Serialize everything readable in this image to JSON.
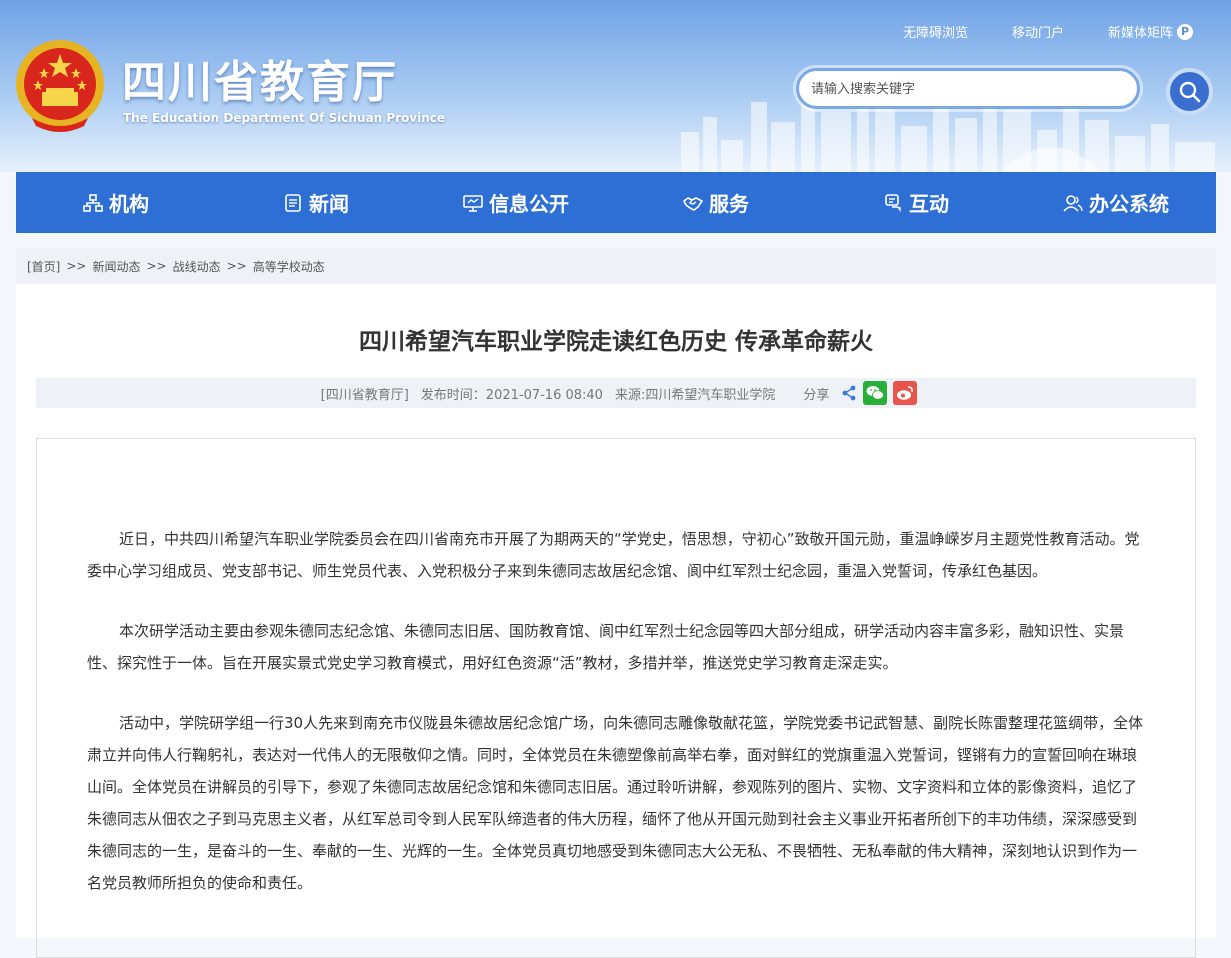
{
  "header": {
    "title": "四川省教育厅",
    "subtitle": "The Education Department Of Sichuan Province",
    "top_links": [
      "无障碍浏览",
      "移动门户",
      "新媒体矩阵"
    ],
    "search_placeholder": "请输入搜索关键字"
  },
  "nav": {
    "items": [
      "机构",
      "新闻",
      "信息公开",
      "服务",
      "互动",
      "办公系统"
    ]
  },
  "breadcrumb": {
    "items": [
      "[首页]",
      "新闻动态",
      "战线动态",
      "高等学校动态"
    ],
    "separator": ">>"
  },
  "article": {
    "title": "四川希望汽车职业学院走读红色历史 传承革命薪火",
    "source_site": "[四川省教育厅]",
    "publish_time": "发布时间：2021-07-16 08:40",
    "source": "来源:四川希望汽车职业学院",
    "share_label": "分享",
    "paragraphs": [
      "近日，中共四川希望汽车职业学院委员会在四川省南充市开展了为期两天的“学党史，悟思想，守初心”致敬开国元勋，重温峥嵘岁月主题党性教育活动。党委中心学习组成员、党支部书记、师生党员代表、入党积极分子来到朱德同志故居纪念馆、阆中红军烈士纪念园，重温入党誓词，传承红色基因。",
      "本次研学活动主要由参观朱德同志纪念馆、朱德同志旧居、国防教育馆、阆中红军烈士纪念园等四大部分组成，研学活动内容丰富多彩，融知识性、实景性、探究性于一体。旨在开展实景式党史学习教育模式，用好红色资源“活”教材，多措并举，推送党史学习教育走深走实。",
      "活动中，学院研学组一行30人先来到南充市仪陇县朱德故居纪念馆广场，向朱德同志雕像敬献花篮，学院党委书记武智慧、副院长陈雷整理花篮绸带，全体肃立并向伟人行鞠躬礼，表达对一代伟人的无限敬仰之情。同时，全体党员在朱德塑像前高举右拳，面对鲜红的党旗重温入党誓词，铿锵有力的宣誓回响在琳琅山间。全体党员在讲解员的引导下，参观了朱德同志故居纪念馆和朱德同志旧居。通过聆听讲解，参观陈列的图片、实物、文字资料和立体的影像资料，追忆了朱德同志从佃农之子到马克思主义者，从红军总司令到人民军队缔造者的伟大历程，缅怀了他从开国元勋到社会主义事业开拓者所创下的丰功伟绩，深深感受到朱德同志的一生，是奋斗的一生、奉献的一生、光辉的一生。全体党员真切地感受到朱德同志大公无私、不畏牺牲、无私奉献的伟大精神，深刻地认识到作为一名党员教师所担负的使命和责任。"
    ]
  },
  "colors": {
    "nav_bg": "#2e6fd6",
    "wechat": "#2aae3a",
    "weibo": "#e8534c"
  }
}
